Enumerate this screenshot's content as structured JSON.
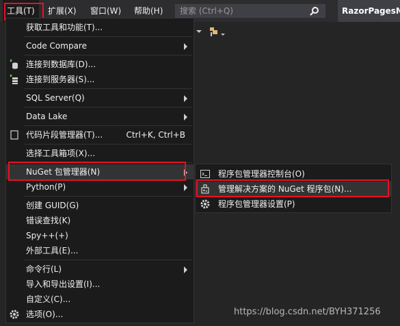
{
  "menubar": {
    "items": [
      "工具(T)",
      "扩展(X)",
      "窗口(W)",
      "帮助(H)"
    ],
    "search_placeholder": "搜索 (Ctrl+Q)",
    "solution_name": "RazorPagesM"
  },
  "tools_menu": {
    "items": [
      {
        "label": "获取工具和功能(T)...",
        "shortcut": "",
        "submenu": false,
        "icon": ""
      },
      {
        "label": "Code Compare",
        "shortcut": "",
        "submenu": true,
        "icon": ""
      },
      {
        "label": "连接到数据库(D)...",
        "shortcut": "",
        "submenu": false,
        "icon": "connect-database-icon"
      },
      {
        "label": "连接到服务器(S)...",
        "shortcut": "",
        "submenu": false,
        "icon": "connect-server-icon"
      },
      {
        "label": "SQL Server(Q)",
        "shortcut": "",
        "submenu": true,
        "icon": ""
      },
      {
        "label": "Data Lake",
        "shortcut": "",
        "submenu": true,
        "icon": ""
      },
      {
        "label": "代码片段管理器(T)...",
        "shortcut": "Ctrl+K, Ctrl+B",
        "submenu": false,
        "icon": "snippet-manager-icon"
      },
      {
        "label": "选择工具箱项(X)...",
        "shortcut": "",
        "submenu": false,
        "icon": ""
      },
      {
        "label": "NuGet 包管理器(N)",
        "shortcut": "",
        "submenu": true,
        "icon": ""
      },
      {
        "label": "Python(P)",
        "shortcut": "",
        "submenu": true,
        "icon": ""
      },
      {
        "label": "创建 GUID(G)",
        "shortcut": "",
        "submenu": false,
        "icon": ""
      },
      {
        "label": "错误查找(K)",
        "shortcut": "",
        "submenu": false,
        "icon": ""
      },
      {
        "label": "Spy++(+)",
        "shortcut": "",
        "submenu": false,
        "icon": ""
      },
      {
        "label": "外部工具(E)...",
        "shortcut": "",
        "submenu": false,
        "icon": ""
      },
      {
        "label": "命令行(L)",
        "shortcut": "",
        "submenu": true,
        "icon": ""
      },
      {
        "label": "导入和导出设置(I)...",
        "shortcut": "",
        "submenu": false,
        "icon": ""
      },
      {
        "label": "自定义(C)...",
        "shortcut": "",
        "submenu": false,
        "icon": ""
      },
      {
        "label": "选项(O)...",
        "shortcut": "",
        "submenu": false,
        "icon": "options-gear-icon"
      }
    ]
  },
  "nuget_submenu": {
    "items": [
      {
        "label": "程序包管理器控制台(O)",
        "icon": "console-icon"
      },
      {
        "label": "管理解决方案的 NuGet 程序包(N)...",
        "icon": "nuget-package-icon"
      },
      {
        "label": "程序包管理器设置(P)",
        "icon": "settings-gear-icon"
      }
    ]
  },
  "watermark": "https://blog.csdn.net/BYH371256",
  "colors": {
    "highlight_box": "#e81123",
    "menu_bg": "#1b1b1c",
    "text": "#f1f1f1"
  }
}
